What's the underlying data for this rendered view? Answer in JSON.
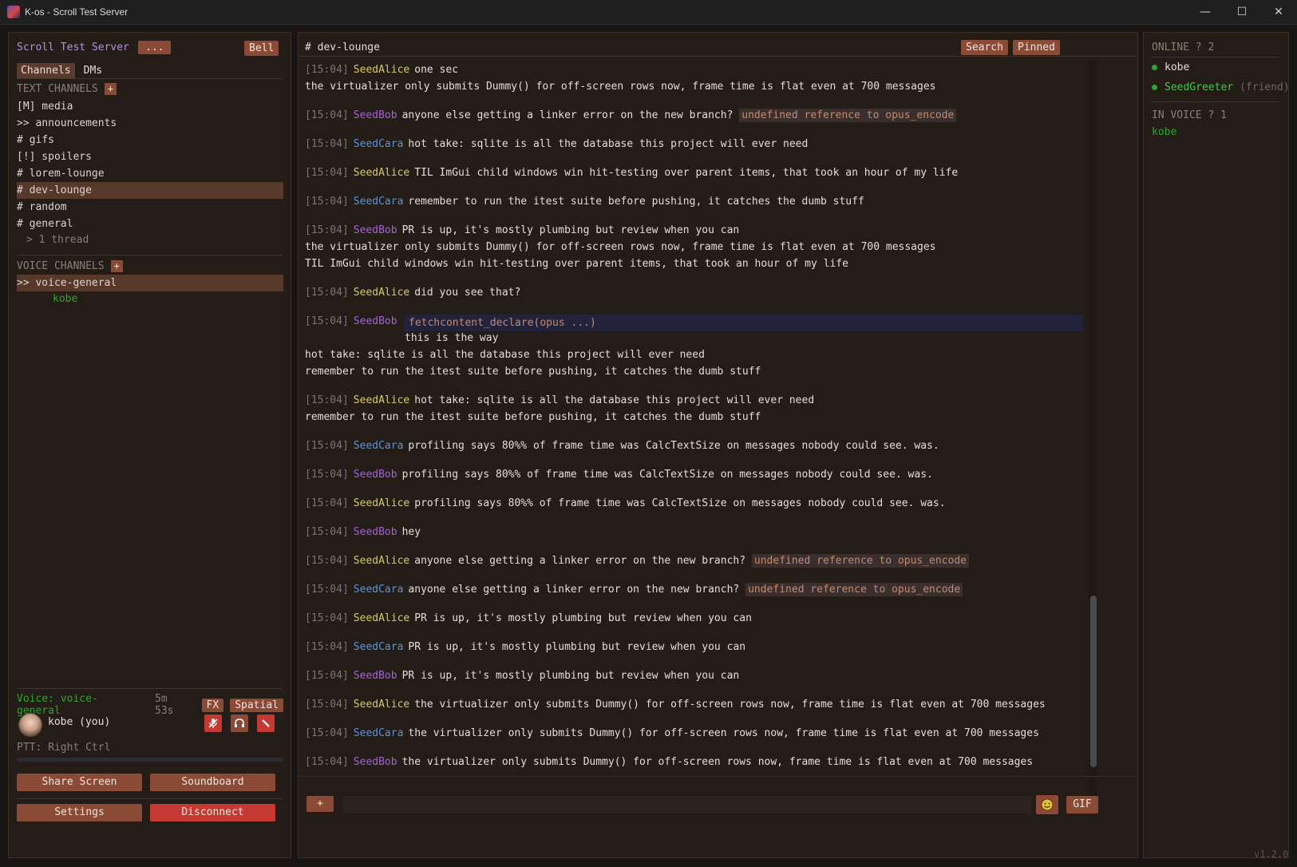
{
  "window": {
    "title": "K-os - Scroll Test Server",
    "controls": [
      "minimize",
      "maximize",
      "close"
    ]
  },
  "sidebar": {
    "server_name": "Scroll Test Server",
    "more_label": "...",
    "bell_label": "Bell",
    "tabs": [
      "Channels",
      "DMs"
    ],
    "text_section": "TEXT CHANNELS",
    "add_label": "+",
    "text_channels": [
      "[M] media",
      ">> announcements",
      "# gifs",
      "[!] spoilers",
      "# lorem-lounge",
      "# dev-lounge",
      "# random",
      "# general"
    ],
    "thread_label": "> 1 thread",
    "voice_section": "VOICE CHANNELS",
    "voice_channels": [
      ">> voice-general"
    ],
    "voice_users": [
      "kobe"
    ],
    "voice_status": {
      "channel": "Voice: voice-general",
      "time": "5m 53s",
      "fx": "FX",
      "spatial": "Spatial"
    },
    "me": {
      "name": "kobe (you)"
    },
    "ptt": "PTT: Right Ctrl",
    "buttons": {
      "share_screen": "Share Screen",
      "soundboard": "Soundboard",
      "settings": "Settings",
      "disconnect": "Disconnect"
    }
  },
  "chat": {
    "channel_title": "# dev-lounge",
    "search_label": "Search",
    "pinned_label": "Pinned",
    "attach_label": "+",
    "gif_label": "GIF",
    "messages": [
      {
        "ts": "[15:04]",
        "author": "SeedAlice",
        "text": "one sec"
      },
      {
        "text": "the virtualizer only submits Dummy() for off-screen rows now, frame time is flat even at 700 messages"
      },
      {
        "ts": "[15:04]",
        "author": "SeedBob",
        "text": "anyone else getting a linker error on the new branch?",
        "code": "undefined reference to opus_encode"
      },
      {
        "ts": "[15:04]",
        "author": "SeedCara",
        "text": "hot take: sqlite is all the database this project will ever need"
      },
      {
        "ts": "[15:04]",
        "author": "SeedAlice",
        "text": "TIL ImGui child windows win hit-testing over parent items, that took an hour of my life"
      },
      {
        "ts": "[15:04]",
        "author": "SeedCara",
        "text": "remember to run the itest suite before pushing, it catches the dumb stuff"
      },
      {
        "ts": "[15:04]",
        "author": "SeedBob",
        "text": "PR is up, it's mostly plumbing but review when you can"
      },
      {
        "text": "the virtualizer only submits Dummy() for off-screen rows now, frame time is flat even at 700 messages"
      },
      {
        "text": "TIL ImGui child windows win hit-testing over parent items, that took an hour of my life"
      },
      {
        "ts": "[15:04]",
        "author": "SeedAlice",
        "text": "did you see that?"
      },
      {
        "ts": "[15:04]",
        "author": "SeedBob",
        "code_block": "fetchcontent_declare(opus ...)"
      },
      {
        "text": "this is the way"
      },
      {
        "text": "hot take: sqlite is all the database this project will ever need"
      },
      {
        "text": "remember to run the itest suite before pushing, it catches the dumb stuff"
      },
      {
        "ts": "[15:04]",
        "author": "SeedAlice",
        "text": "hot take: sqlite is all the database this project will ever need"
      },
      {
        "text": "remember to run the itest suite before pushing, it catches the dumb stuff"
      },
      {
        "ts": "[15:04]",
        "author": "SeedCara",
        "text": "profiling says 80%% of frame time was CalcTextSize on messages nobody could see. was."
      },
      {
        "ts": "[15:04]",
        "author": "SeedBob",
        "text": "profiling says 80%% of frame time was CalcTextSize on messages nobody could see. was."
      },
      {
        "ts": "[15:04]",
        "author": "SeedAlice",
        "text": "profiling says 80%% of frame time was CalcTextSize on messages nobody could see. was."
      },
      {
        "ts": "[15:04]",
        "author": "SeedBob",
        "text": "hey"
      },
      {
        "ts": "[15:04]",
        "author": "SeedAlice",
        "text": "anyone else getting a linker error on the new branch?",
        "code": "undefined reference to opus_encode"
      },
      {
        "ts": "[15:04]",
        "author": "SeedCara",
        "text": "anyone else getting a linker error on the new branch?",
        "code": "undefined reference to opus_encode"
      },
      {
        "ts": "[15:04]",
        "author": "SeedAlice",
        "text": "PR is up, it's mostly plumbing but review when you can"
      },
      {
        "ts": "[15:04]",
        "author": "SeedCara",
        "text": "PR is up, it's mostly plumbing but review when you can"
      },
      {
        "ts": "[15:04]",
        "author": "SeedBob",
        "text": "PR is up, it's mostly plumbing but review when you can"
      },
      {
        "ts": "[15:04]",
        "author": "SeedAlice",
        "text": "the virtualizer only submits Dummy() for off-screen rows now, frame time is flat even at 700 messages"
      },
      {
        "ts": "[15:04]",
        "author": "SeedCara",
        "text": "the virtualizer only submits Dummy() for off-screen rows now, frame time is flat even at 700 messages"
      },
      {
        "ts": "[15:04]",
        "author": "SeedBob",
        "text": "the virtualizer only submits Dummy() for off-screen rows now, frame time is flat even at 700 messages"
      }
    ]
  },
  "members": {
    "online_header": "ONLINE ? 2",
    "online": [
      {
        "name": "kobe",
        "note": ""
      },
      {
        "name": "SeedGreeter",
        "note": "(friend)"
      }
    ],
    "voice_header": "IN VOICE ? 1",
    "in_voice": [
      "kobe"
    ]
  },
  "version": "v1.2.0",
  "colors": {
    "accent": "#8a4a35",
    "danger": "#c43a32",
    "online": "#2ea52e",
    "alice": "#d8c96a",
    "bob": "#a563d8",
    "cara": "#5b94d8",
    "server_name": "#b593dc"
  },
  "icons": {
    "mute": "mic-slash-icon",
    "deafen": "headphones-icon",
    "disconnect": "phone-hangup-icon",
    "emoji": "smiley-icon",
    "app": "app-logo-icon"
  }
}
